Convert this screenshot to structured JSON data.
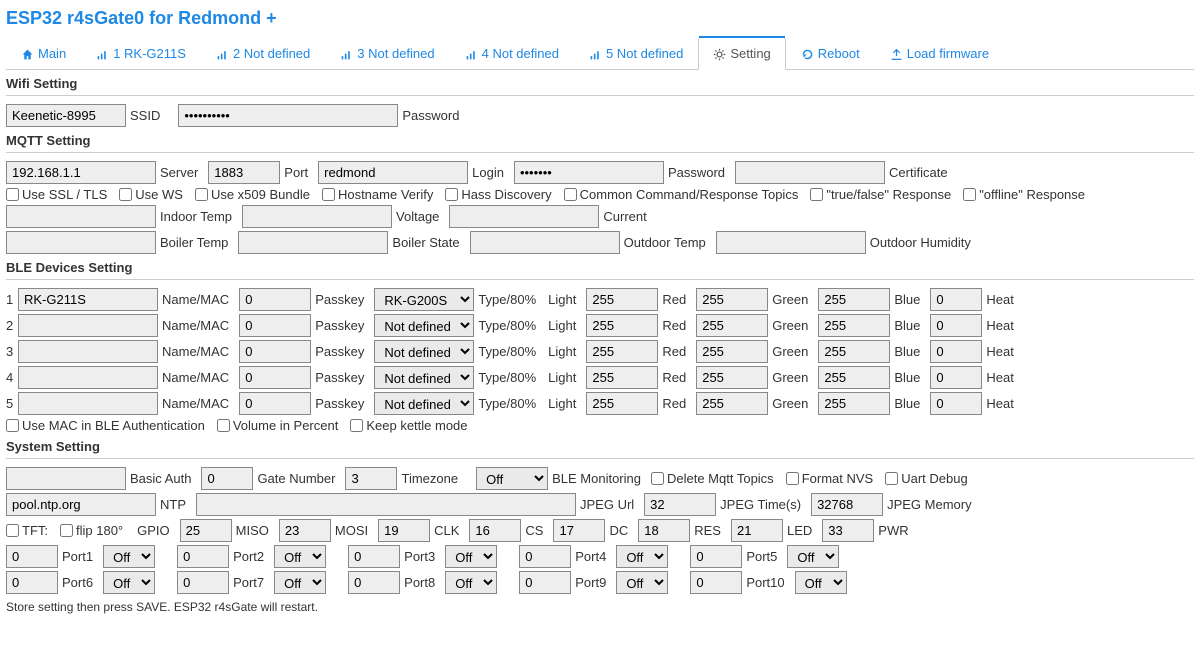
{
  "title": "ESP32 r4sGate0 for Redmond +",
  "tabs": {
    "main": "Main",
    "d1": "1 RK-G211S",
    "d2": "2 Not defined",
    "d3": "3 Not defined",
    "d4": "4 Not defined",
    "d5": "5 Not defined",
    "setting": "Setting",
    "reboot": "Reboot",
    "load": "Load firmware"
  },
  "sections": {
    "wifi": "Wifi Setting",
    "mqtt": "MQTT Setting",
    "ble": "BLE Devices Setting",
    "system": "System Setting"
  },
  "wifi": {
    "ssid": "Keenetic-8995",
    "ssid_label": "SSID",
    "password": "••••••••••",
    "password_label": "Password"
  },
  "mqtt": {
    "server": "192.168.1.1",
    "server_label": "Server",
    "port": "1883",
    "port_label": "Port",
    "login": "redmond",
    "login_label": "Login",
    "password": "•••••••",
    "password_label": "Password",
    "cert": "",
    "cert_label": "Certificate",
    "cb": {
      "ssl": "Use SSL / TLS",
      "ws": "Use WS",
      "x509": "Use x509 Bundle",
      "hostv": "Hostname Verify",
      "hass": "Hass Discovery",
      "common": "Common Command/Response Topics",
      "tfresp": "\"true/false\" Response",
      "offresp": "\"offline\" Response"
    },
    "extras": {
      "indoor": "Indoor Temp",
      "voltage": "Voltage",
      "current": "Current",
      "boilertemp": "Boiler Temp",
      "boilerstate": "Boiler State",
      "outdoor": "Outdoor Temp",
      "outhum": "Outdoor Humidity"
    }
  },
  "ble": {
    "labels": {
      "name": "Name/MAC",
      "passkey": "Passkey",
      "type": "Type/80%",
      "light": "Light",
      "red": "Red",
      "green": "Green",
      "blue": "Blue",
      "heat": "Heat"
    },
    "rows": [
      {
        "idx": "1",
        "name": "RK-G211S",
        "passkey": "0",
        "type": "RK-G200S",
        "r": "255",
        "g": "255",
        "b": "255",
        "heat": "0"
      },
      {
        "idx": "2",
        "name": "",
        "passkey": "0",
        "type": "Not defined",
        "r": "255",
        "g": "255",
        "b": "255",
        "heat": "0"
      },
      {
        "idx": "3",
        "name": "",
        "passkey": "0",
        "type": "Not defined",
        "r": "255",
        "g": "255",
        "b": "255",
        "heat": "0"
      },
      {
        "idx": "4",
        "name": "",
        "passkey": "0",
        "type": "Not defined",
        "r": "255",
        "g": "255",
        "b": "255",
        "heat": "0"
      },
      {
        "idx": "5",
        "name": "",
        "passkey": "0",
        "type": "Not defined",
        "r": "255",
        "g": "255",
        "b": "255",
        "heat": "0"
      }
    ],
    "cb": {
      "macauth": "Use MAC in BLE Authentication",
      "volpct": "Volume in Percent",
      "keepkettle": "Keep kettle mode"
    }
  },
  "system": {
    "labels": {
      "basicauth": "Basic Auth",
      "gate": "Gate Number",
      "tz": "Timezone",
      "blemon": "BLE Monitoring",
      "deltopics": "Delete Mqtt Topics",
      "fmtnvs": "Format NVS",
      "uart": "Uart Debug",
      "ntp": "NTP",
      "jpegurl": "JPEG Url",
      "jpegtime": "JPEG Time(s)",
      "jpegmem": "JPEG Memory",
      "tft": "TFT:",
      "flip": "flip 180°",
      "gpio": "GPIO",
      "miso": "MISO",
      "mosi": "MOSI",
      "clk": "CLK",
      "cs": "CS",
      "dc": "DC",
      "res": "RES",
      "led": "LED",
      "pwr": "PWR"
    },
    "values": {
      "basicauth": "",
      "gate": "0",
      "tz": "3",
      "blemon": "Off",
      "ntp": "pool.ntp.org",
      "jpegurl": "",
      "jpegtime": "32",
      "jpegmem": "32768",
      "gpio": "25",
      "mosi": "23",
      "clk": "19",
      "cs": "16",
      "dc": "17",
      "res": "18",
      "led": "21",
      "pwr": "33"
    },
    "ports": [
      {
        "n": "Port1",
        "v": "0",
        "m": "Off"
      },
      {
        "n": "Port2",
        "v": "0",
        "m": "Off"
      },
      {
        "n": "Port3",
        "v": "0",
        "m": "Off"
      },
      {
        "n": "Port4",
        "v": "0",
        "m": "Off"
      },
      {
        "n": "Port5",
        "v": "0",
        "m": "Off"
      },
      {
        "n": "Port6",
        "v": "0",
        "m": "Off"
      },
      {
        "n": "Port7",
        "v": "0",
        "m": "Off"
      },
      {
        "n": "Port8",
        "v": "0",
        "m": "Off"
      },
      {
        "n": "Port9",
        "v": "0",
        "m": "Off"
      },
      {
        "n": "Port10",
        "v": "0",
        "m": "Off"
      }
    ]
  },
  "footnote": "Store setting then press SAVE. ESP32 r4sGate will restart."
}
